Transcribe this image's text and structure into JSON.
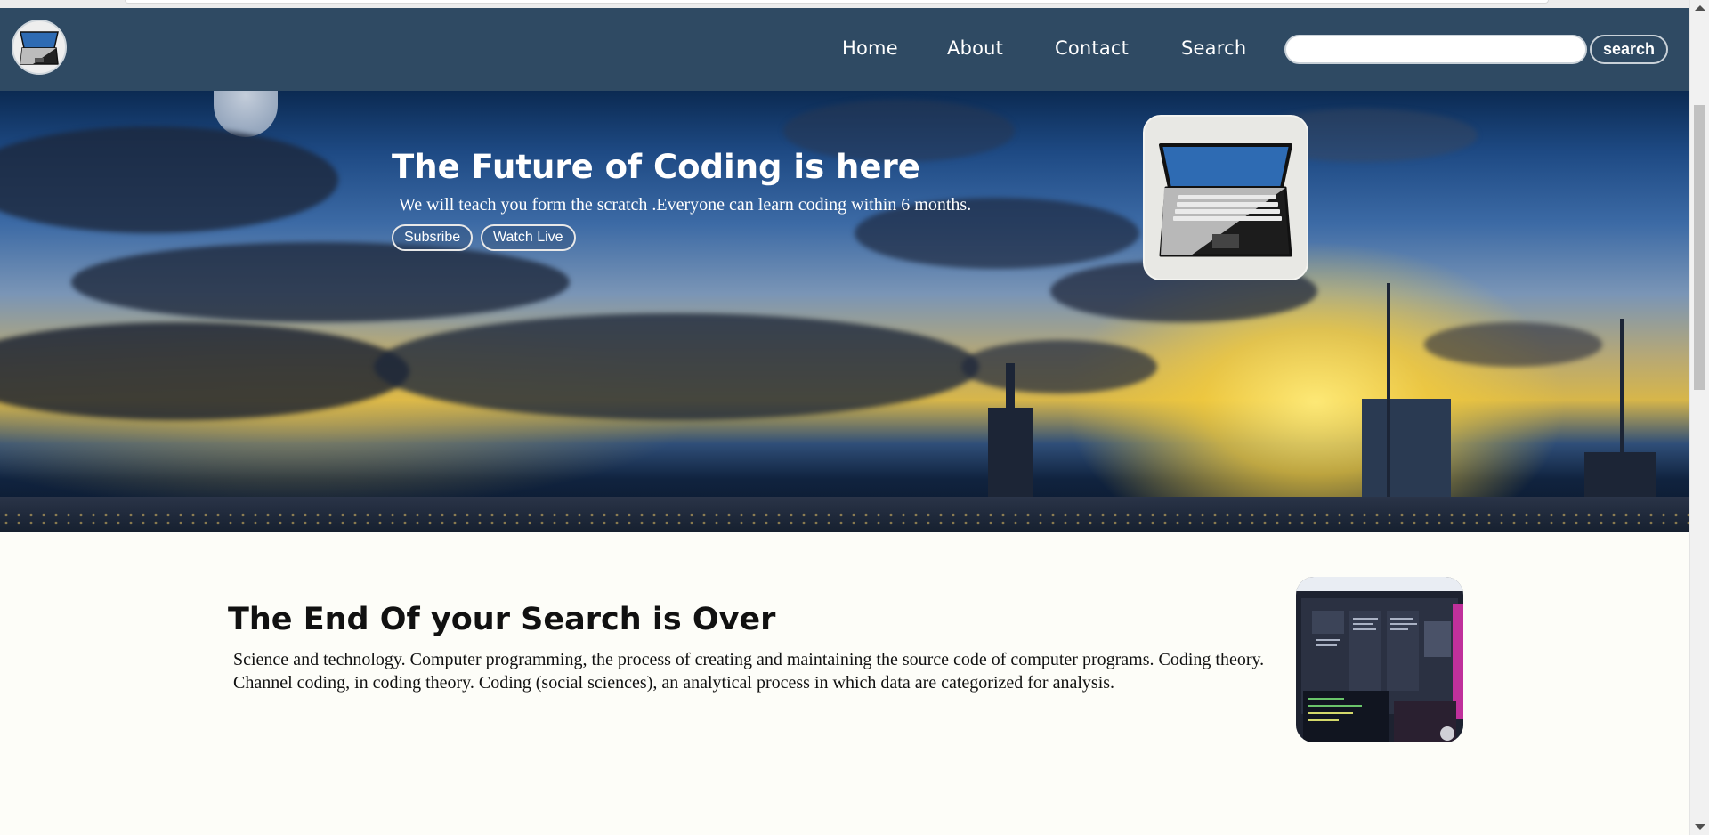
{
  "navbar": {
    "links": [
      {
        "label": "Home"
      },
      {
        "label": "About"
      },
      {
        "label": "Contact"
      },
      {
        "label": "Search"
      }
    ],
    "search_placeholder": "",
    "search_button": "search"
  },
  "hero": {
    "title": "The Future of Coding is here",
    "subtitle": "We will teach you form the scratch .Everyone can learn coding within 6 months.",
    "buttons": [
      {
        "label": "Subsribe"
      },
      {
        "label": "Watch Live"
      }
    ]
  },
  "section": {
    "title": "The End Of your Search is Over",
    "text": "Science and technology. Computer programming, the process of creating and maintaining the source code of computer programs. Coding theory. Channel coding, in coding theory. Coding (social sciences), an analytical process in which data are categorized for analysis."
  },
  "colors": {
    "navbar_bg": "#2f4a63",
    "page_bg": "#fdfdf8",
    "laptop_screen": "#2e6bb3"
  },
  "icons": {
    "logo": "laptop-icon",
    "hero_card": "laptop-icon",
    "photo": "code-screen-photo"
  }
}
